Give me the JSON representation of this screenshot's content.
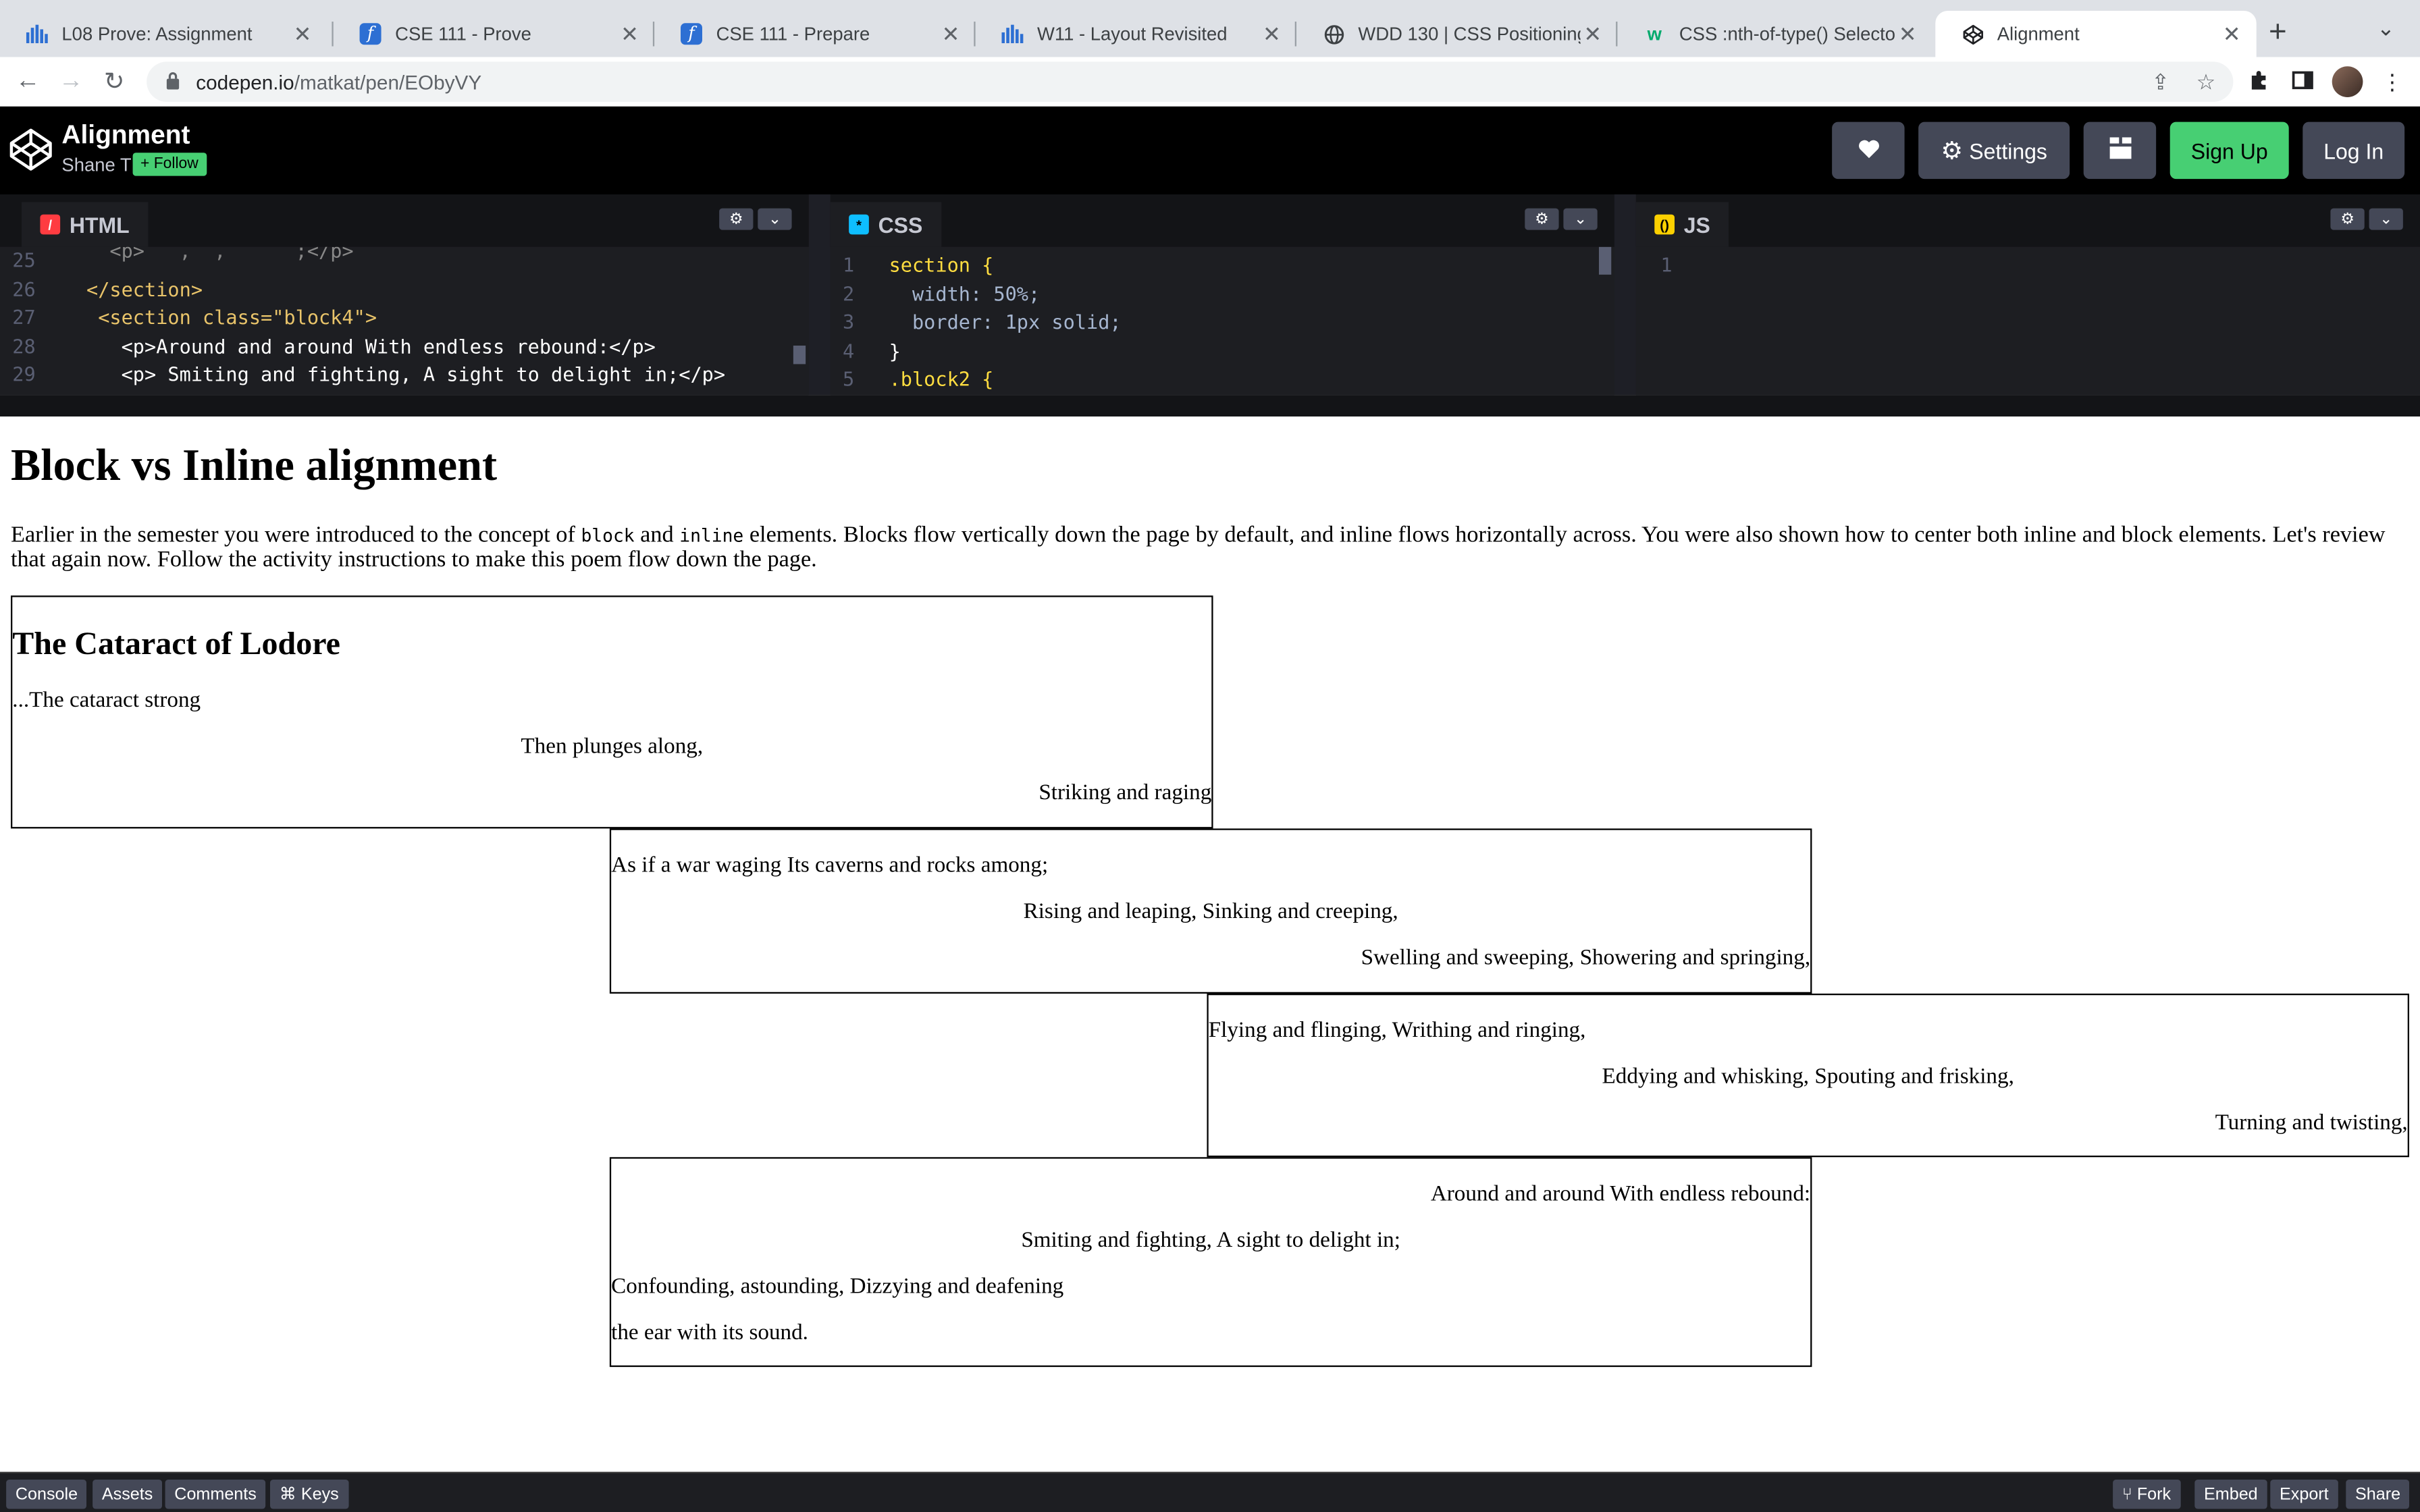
{
  "browser": {
    "tabs": [
      {
        "title": "L08 Prove: Assignment",
        "icon": "canvas-icon"
      },
      {
        "title": "CSE 111 - Prove",
        "icon": "f-icon"
      },
      {
        "title": "CSE 111 - Prepare",
        "icon": "f-icon"
      },
      {
        "title": "W11 - Layout Revisited",
        "icon": "canvas-icon"
      },
      {
        "title": "WDD 130 | CSS Positioning II A",
        "icon": "globe-icon"
      },
      {
        "title": "CSS :nth-of-type() Selector",
        "icon": "w3-icon"
      },
      {
        "title": "Alignment",
        "icon": "codepen-icon"
      }
    ],
    "active_tab": "Alignment",
    "url_domain": "codepen.io",
    "url_path": "/matkat/pen/EObyVY"
  },
  "codepen": {
    "pen_title": "Alignment",
    "author": "Shane T",
    "follow_label": "+ Follow",
    "settings_label": "Settings",
    "signup_label": "Sign Up",
    "login_label": "Log In",
    "html_tab": "HTML",
    "css_tab": "CSS",
    "js_tab": "JS",
    "html_code": [
      {
        "line": "25",
        "text": ""
      },
      {
        "line": "26",
        "text": "</section>"
      },
      {
        "line": "27",
        "text": " <section class=\"block4\">"
      },
      {
        "line": "28",
        "text": "   <p>Around and around With endless rebound:</p>"
      },
      {
        "line": "29",
        "text": "   <p> Smiting and fighting, A sight to delight in;</p>"
      }
    ],
    "css_code": [
      {
        "line": "1",
        "text": "section {"
      },
      {
        "line": "2",
        "text": "  width: 50%;"
      },
      {
        "line": "3",
        "text": "  border: 1px solid;"
      },
      {
        "line": "4",
        "text": "}"
      },
      {
        "line": "5",
        "text": ".block2 {"
      }
    ],
    "js_code": [
      {
        "line": "1",
        "text": ""
      }
    ],
    "bottom_left": [
      "Console",
      "Assets",
      "Comments",
      "⌘ Keys"
    ],
    "bottom_right": [
      "Fork",
      "Embed",
      "Export",
      "Share"
    ]
  },
  "preview": {
    "heading": "Block vs Inline alignment",
    "intro_before_block": "Earlier in the semester you were introduced to the concept of",
    "code_block": "block",
    "intro_and": "and",
    "code_inline": "inline",
    "intro_after": "elements. Blocks flow vertically down the page by default, and inline flows horizontally across. You were also shown how to center both inline and block elements. Let's review that again now. Follow the activity instructions to make this poem flow down the page.",
    "poem_title": "The Cataract of Lodore",
    "block1": [
      "...The cataract strong",
      "Then plunges along,",
      "Striking and raging"
    ],
    "block2": [
      "As if a war waging Its caverns and rocks among;",
      "Rising and leaping, Sinking and creeping,",
      "Swelling and sweeping, Showering and springing,"
    ],
    "block3": [
      "Flying and flinging, Writhing and ringing,",
      "Eddying and whisking, Spouting and frisking,",
      "Turning and twisting,"
    ],
    "block4": [
      "Around and around With endless rebound:",
      "Smiting and fighting, A sight to delight in;",
      "Confounding, astounding, Dizzying and deafening",
      "the ear with its sound."
    ]
  }
}
